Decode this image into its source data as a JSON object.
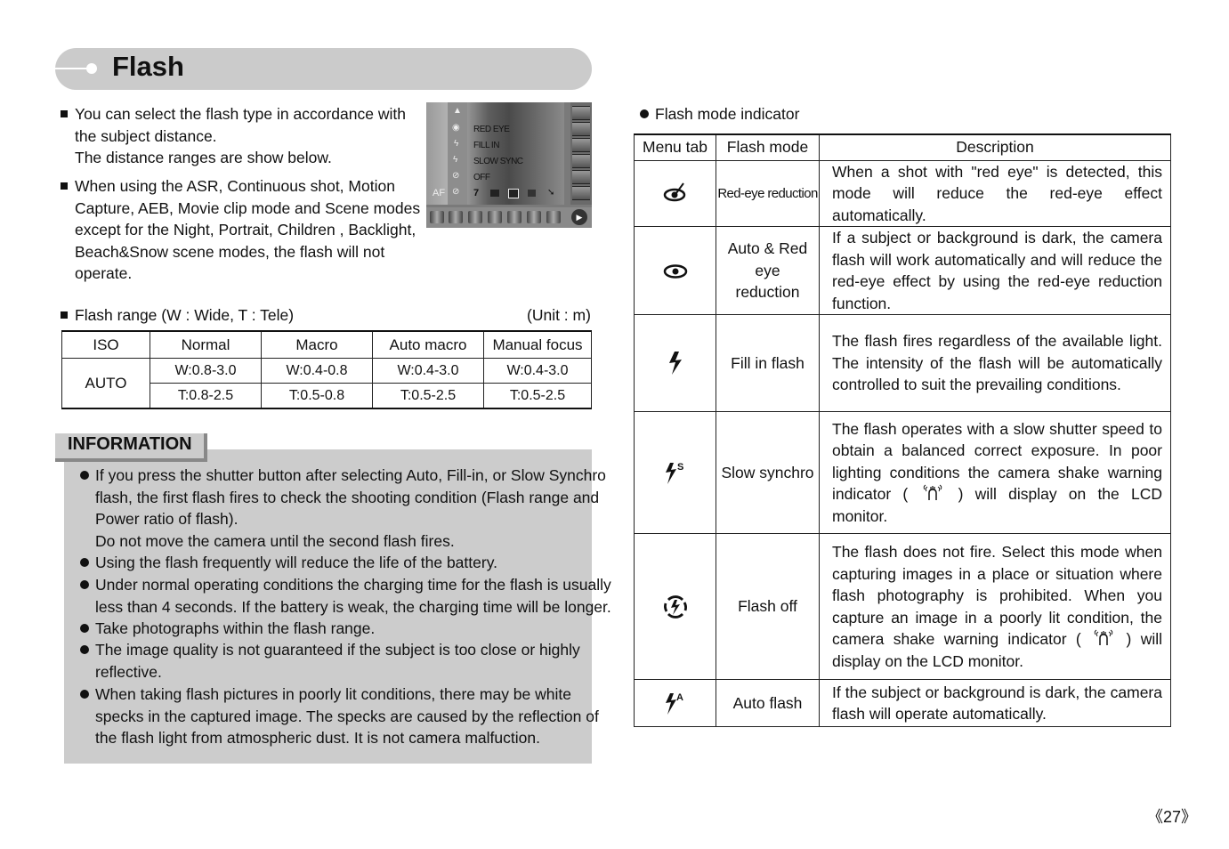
{
  "header": {
    "title": "Flash"
  },
  "intro": {
    "bullets": [
      [
        "You can select the flash type in accordance with",
        "the subject distance.",
        "The distance ranges are show below."
      ],
      [
        "When using the ASR, Continuous shot, Motion",
        "Capture, AEB, Movie clip mode and Scene modes",
        "except for the Night, Portrait, Children , Backlight,",
        "Beach&Snow scene modes, the flash will not",
        "operate."
      ]
    ]
  },
  "lcd": {
    "menu_items": [
      "RED EYE",
      "FILL IN",
      "SLOW SYNC",
      "OFF"
    ],
    "status_left": "AF",
    "status_num": "7"
  },
  "flash_range": {
    "label": "Flash range (W : Wide, T : Tele)",
    "unit": "(Unit : m)",
    "headers": [
      "ISO",
      "Normal",
      "Macro",
      "Auto macro",
      "Manual focus"
    ],
    "iso": "AUTO",
    "wide": [
      "W:0.8-3.0",
      "W:0.4-0.8",
      "W:0.4-3.0",
      "W:0.4-3.0"
    ],
    "tele": [
      "T:0.8-2.5",
      "T:0.5-0.8",
      "T:0.5-2.5",
      "T:0.5-2.5"
    ]
  },
  "information": {
    "title": "INFORMATION",
    "bullets": [
      [
        "If you press the shutter button after selecting Auto, Fill-in, or Slow Synchro",
        "flash, the first flash fires to check the shooting condition (Flash range and",
        "Power ratio of flash).",
        "Do not move the camera until the second flash fires."
      ],
      [
        "Using the flash frequently will reduce the life of the battery."
      ],
      [
        "Under normal operating conditions the charging time for the flash is usually",
        "less than 4 seconds. If the battery is weak, the charging time will be longer."
      ],
      [
        "Take photographs within the flash range."
      ],
      [
        "The image quality is not guaranteed if the subject is too close or highly",
        "reflective."
      ],
      [
        "When taking flash pictures in poorly lit conditions, there may be white",
        "specks in the captured image. The specks are caused by the reflection of",
        "the flash light from atmospheric dust. It is not camera malfuction."
      ]
    ]
  },
  "mode_indicator": {
    "label": "Flash mode indicator",
    "headers": [
      "Menu tab",
      "Flash mode",
      "Description"
    ],
    "rows": [
      {
        "icon": "red-eye-reduction-icon",
        "mode": "Red-eye reduction",
        "desc_pre": "When a shot with \"red eye\" is detected, this mode will reduce the red-eye effect automatically.",
        "desc_post": ""
      },
      {
        "icon": "auto-red-eye-icon",
        "mode": "Auto & Red eye reduction",
        "desc_pre": "If a subject or background is dark, the camera flash will work automatically and will reduce the red-eye effect by using the red-eye reduction function.",
        "desc_post": ""
      },
      {
        "icon": "fill-in-flash-icon",
        "mode": "Fill in flash",
        "desc_pre": "The flash fires regardless of the available light. The intensity of the flash will be automatically controlled to suit the prevailing conditions.",
        "desc_post": ""
      },
      {
        "icon": "slow-synchro-icon",
        "mode": "Slow synchro",
        "desc_pre": "The flash operates with a slow shutter speed to obtain a balanced correct exposure. In poor lighting conditions the camera shake warning indicator (",
        "desc_post": ") will display on the LCD monitor."
      },
      {
        "icon": "flash-off-icon",
        "mode": "Flash off",
        "desc_pre": "The flash does not fire. Select this mode when capturing images in a place or situation where flash photography is prohibited. When you capture an image in a poorly lit condition, the camera shake warning indicator (",
        "desc_post": ") will display on the LCD monitor."
      },
      {
        "icon": "auto-flash-icon",
        "mode": "Auto flash",
        "desc_pre": "If the subject or background is dark, the camera flash will operate automatically.",
        "desc_post": ""
      }
    ]
  },
  "page_number": "《27》"
}
